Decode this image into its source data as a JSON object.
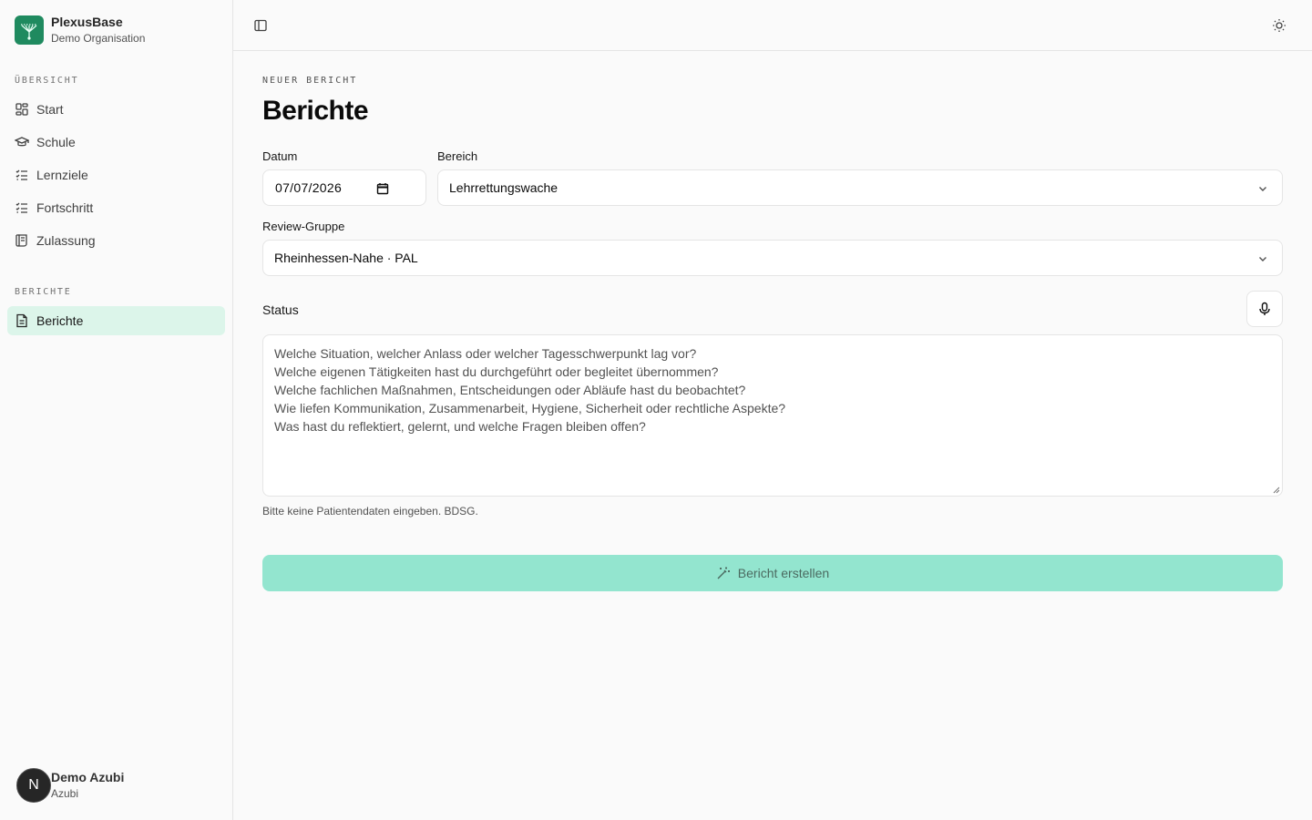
{
  "brand": {
    "name": "PlexusBase",
    "organisation": "Demo Organisation"
  },
  "sidebar": {
    "overview_label": "ÜBERSICHT",
    "items": [
      {
        "label": "Start",
        "icon": "dashboard-icon"
      },
      {
        "label": "Schule",
        "icon": "graduation-cap-icon"
      },
      {
        "label": "Lernziele",
        "icon": "checklist-icon"
      },
      {
        "label": "Fortschritt",
        "icon": "checklist-icon"
      },
      {
        "label": "Zulassung",
        "icon": "scroll-icon"
      }
    ],
    "reports_label": "BERICHTE",
    "report_items": [
      {
        "label": "Berichte",
        "icon": "file-text-icon",
        "active": true
      }
    ]
  },
  "user": {
    "initial": "N",
    "name": "Demo Azubi",
    "role": "Azubi"
  },
  "header": {
    "eyebrow": "NEUER BERICHT",
    "title": "Berichte"
  },
  "form": {
    "date_label": "Datum",
    "date_value": "07/07/2026",
    "area_label": "Bereich",
    "area_value": "Lehrrettungswache",
    "group_label": "Review-Gruppe",
    "group_value": "Rheinhessen-Nahe · PAL",
    "status_label": "Status",
    "status_placeholder_lines": [
      "Welche Situation, welcher Anlass oder welcher Tagesschwerpunkt lag vor?",
      "Welche eigenen Tätigkeiten hast du durchgeführt oder begleitet übernommen?",
      "Welche fachlichen Maßnahmen, Entscheidungen oder Abläufe hast du beobachtet?",
      "Wie liefen Kommunikation, Zusammenarbeit, Hygiene, Sicherheit oder rechtliche Aspekte?",
      "Was hast du reflektiert, gelernt, und welche Fragen bleiben offen?"
    ],
    "hint": "Bitte keine Patientendaten eingeben. BDSG.",
    "submit_label": "Bericht erstellen"
  },
  "colors": {
    "accent": "#1f8a5f",
    "active_bg": "#dcf5ea",
    "submit_bg": "#93e5cf"
  }
}
